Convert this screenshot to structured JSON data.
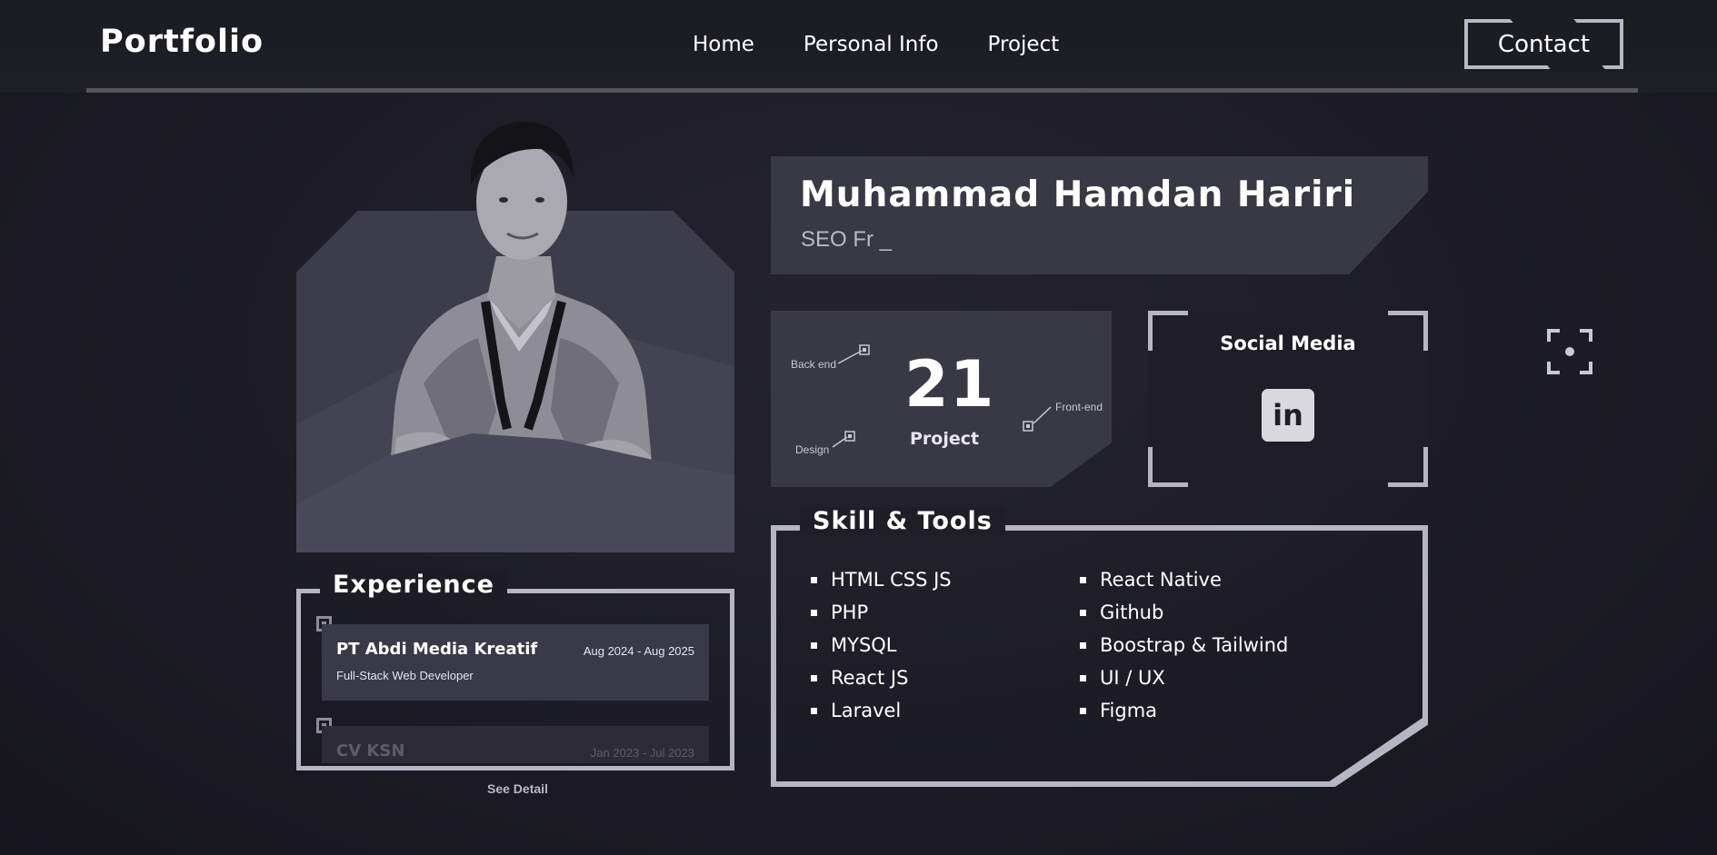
{
  "header": {
    "logo": "Portfolio",
    "nav": [
      "Home",
      "Personal Info",
      "Project"
    ],
    "contact_label": "Contact"
  },
  "profile": {
    "name": "Muhammad Hamdan Hariri",
    "role_typed": "SEO Fr _"
  },
  "stats": {
    "count": "21",
    "label": "Project",
    "tags": [
      "Back end",
      "Design",
      "Front-end"
    ]
  },
  "social": {
    "title": "Social Media",
    "linkedin_icon": "linkedin-icon",
    "linkedin_text": "in"
  },
  "skills": {
    "title": "Skill & Tools",
    "left": [
      "HTML CSS JS",
      "PHP",
      "MYSQL",
      "React JS",
      "Laravel"
    ],
    "right": [
      "React Native",
      "Github",
      "Boostrap & Tailwind",
      "UI / UX",
      "Figma"
    ]
  },
  "experience": {
    "title": "Experience",
    "items": [
      {
        "company": "PT Abdi Media Kreatif",
        "date": "Aug 2024 - Aug 2025",
        "role": "Full-Stack Web Developer"
      },
      {
        "company": "CV KSN",
        "date": "Jan 2023 - Jul 2023",
        "role": ""
      }
    ],
    "see_detail": "See Detail"
  },
  "colors": {
    "background": "#1c1b25",
    "panel": "#393845",
    "frame": "#b6b5c4",
    "text": "#ffffff"
  }
}
